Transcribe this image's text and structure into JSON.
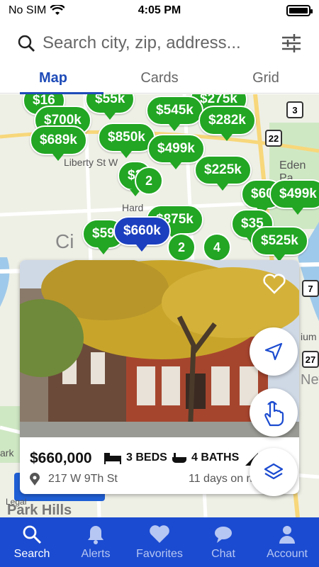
{
  "status": {
    "carrier": "No SIM",
    "time": "4:05 PM"
  },
  "search": {
    "placeholder": "Search city, zip, address..."
  },
  "tabs": [
    {
      "label": "Map"
    },
    {
      "label": "Cards"
    },
    {
      "label": "Grid"
    }
  ],
  "map": {
    "pins": [
      "$16",
      "$55k",
      "$275k",
      "$545k",
      "$282k",
      "$700k",
      "$689k",
      "$850k",
      "$499k",
      "$225k",
      "$2",
      "$60",
      "$499k",
      "$875k",
      "$35",
      "$525k",
      "$59",
      "$660k"
    ],
    "clusters": [
      "2",
      "2",
      "4"
    ],
    "labels": {
      "street": "Liberty St W",
      "eden": "Eden Pa",
      "hard": "Hard",
      "ci": "Ci",
      "new": "New",
      "ium": "ium",
      "park": "ark"
    },
    "shields": [
      "3",
      "22",
      "27",
      "7"
    ],
    "park_hills": "Park Hills",
    "legal": "Legal"
  },
  "card": {
    "price": "$660,000",
    "beds": "3 BEDS",
    "baths": "4 BATHS",
    "address": "217 W 9Th St",
    "days": "11 days on m"
  },
  "nav": [
    {
      "label": "Search",
      "icon": "search-icon"
    },
    {
      "label": "Alerts",
      "icon": "bell-icon"
    },
    {
      "label": "Favorites",
      "icon": "heart-icon"
    },
    {
      "label": "Chat",
      "icon": "chat-icon"
    },
    {
      "label": "Account",
      "icon": "person-icon"
    }
  ],
  "colors": {
    "brand": "#1b4bd0",
    "pin": "#22a623",
    "selected_pin": "#1b3fbf"
  }
}
